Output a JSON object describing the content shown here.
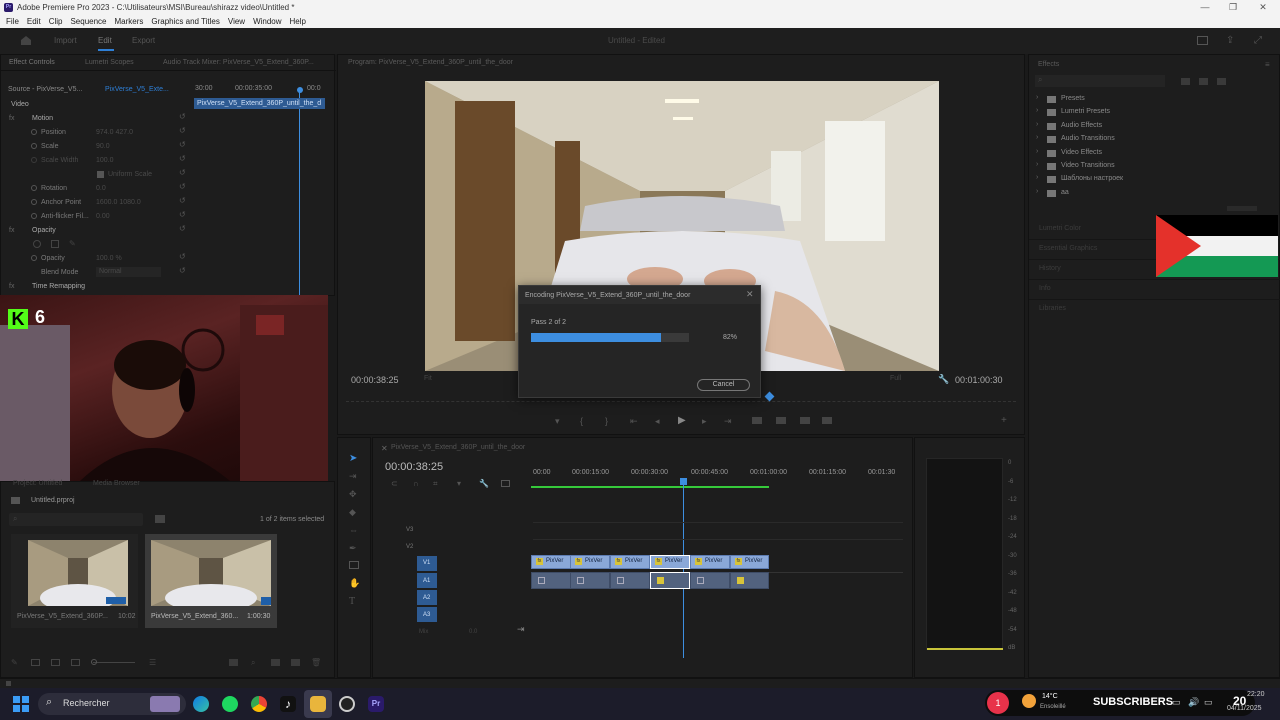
{
  "window": {
    "title": "Adobe Premiere Pro 2023 - C:\\Utilisateurs\\MSI\\Bureau\\shirazz video\\Untitled *",
    "app_icon": "Pr"
  },
  "menu": [
    "File",
    "Edit",
    "Clip",
    "Sequence",
    "Markers",
    "Graphics and Titles",
    "View",
    "Window",
    "Help"
  ],
  "workspace": {
    "tabs": [
      "Import",
      "Edit",
      "Export"
    ],
    "project_status": "Untitled - Edited"
  },
  "effect_controls": {
    "tabs": [
      "Effect Controls",
      "Lumetri Scopes",
      "Audio Track Mixer: PixVerse_V5_Extend_360P..."
    ],
    "source": "Source - PixVerse_V5...",
    "clip": "PixVerse_V5_Exte...",
    "ruler": [
      "30:00",
      "00:00:35:00",
      "00:0"
    ],
    "clip_bar": "PixVerse_V5_Extend_360P_until_the_d",
    "section_video": "Video",
    "rows": [
      {
        "name": "Motion",
        "value": ""
      },
      {
        "name": "Position",
        "value": "974.0     427.0"
      },
      {
        "name": "Scale",
        "value": "90.0"
      },
      {
        "name": "Scale Width",
        "value": "100.0"
      },
      {
        "name": "",
        "value": "Uniform Scale"
      },
      {
        "name": "Rotation",
        "value": "0.0"
      },
      {
        "name": "Anchor Point",
        "value": "1600.0     1080.0"
      },
      {
        "name": "Anti-flicker Fil...",
        "value": "0.00"
      },
      {
        "name": "Opacity",
        "value": ""
      },
      {
        "name": "Opacity",
        "value": "100.0 %"
      },
      {
        "name": "Blend Mode",
        "value": "Normal"
      },
      {
        "name": "Time Remapping",
        "value": ""
      }
    ]
  },
  "overlay": {
    "kick_logo": "K",
    "kick_count": "6"
  },
  "project": {
    "tabs": [
      "Project: Untitled",
      "Media Browser"
    ],
    "file": "Untitled.prproj",
    "selection": "1 of 2 items selected",
    "items": [
      {
        "name": "PixVerse_V5_Extend_360P...",
        "duration": "10:02"
      },
      {
        "name": "PixVerse_V5_Extend_360...",
        "duration": "1:00:30"
      }
    ]
  },
  "program": {
    "tab": "Program: PixVerse_V5_Extend_360P_until_the_door",
    "timecode_left": "00:00:38:25",
    "fit": "Fit",
    "quality": "Full",
    "timecode_right": "00:01:00:30"
  },
  "encoding_dialog": {
    "title": "Encoding PixVerse_V5_Extend_360P_until_the_door",
    "pass": "Pass 2 of 2",
    "progress": 82,
    "progress_label": "82%",
    "cancel": "Cancel"
  },
  "timeline": {
    "tab": "PixVerse_V5_Extend_360P_until_the_door",
    "timecode": "00:00:38:25",
    "ruler": [
      "00:00",
      "00:00:15:00",
      "00:00:30:00",
      "00:00:45:00",
      "00:01:00:00",
      "00:01:15:00",
      "00:01:30"
    ],
    "video_tracks": [
      "V3",
      "V2",
      "V1"
    ],
    "audio_tracks": [
      "A1",
      "A2",
      "A3"
    ],
    "mix": "Mix",
    "mix_value": "0.0",
    "clip_label": "PixVer"
  },
  "meter": {
    "scale": [
      "0",
      "-6",
      "-12",
      "-18",
      "-24",
      "-30",
      "-36",
      "-42",
      "-48",
      "-54",
      "dB"
    ]
  },
  "effects": {
    "tab": "Effects",
    "items": [
      "Presets",
      "Lumetri Presets",
      "Audio Effects",
      "Audio Transitions",
      "Video Effects",
      "Video Transitions",
      "Шаблоны настроек",
      "aa"
    ],
    "collapsed_panels": [
      "Lumetri Color",
      "Essential Graphics",
      "History",
      "Info",
      "Libraries"
    ]
  },
  "taskbar": {
    "search": "Rechercher",
    "weather_temp": "14°C",
    "weather_sub": "Ensoleillé",
    "subscribers": "SUBSCRIBERS",
    "subs_count": "1",
    "time": "22:20",
    "date": "04/11/2025",
    "counter": "20"
  },
  "colors": {
    "accent_blue": "#2e7fd6",
    "clip_video": "#8aa8d8",
    "clip_audio": "#52627e",
    "playhead": "#3d8ee0",
    "work_area": "#36c93b"
  }
}
